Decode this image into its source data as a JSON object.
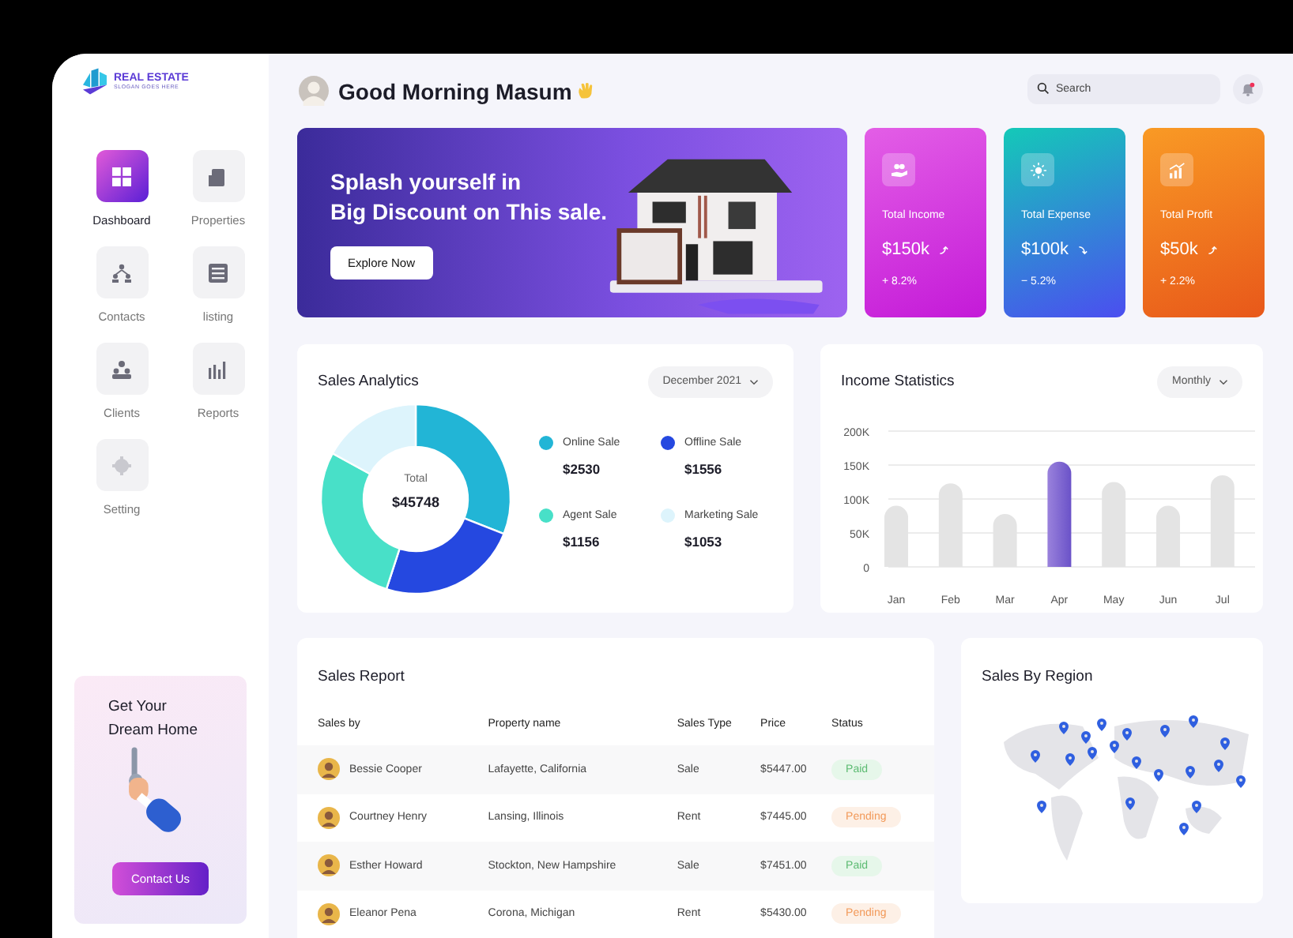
{
  "brand": {
    "name": "REAL ESTATE",
    "slogan": "SLOGAN GOES HERE"
  },
  "sidebar": {
    "items": [
      {
        "label": "Dashboard",
        "kind": "dashboard",
        "selected": true
      },
      {
        "label": "Properties",
        "kind": "properties",
        "selected": false
      },
      {
        "label": "Contacts",
        "kind": "contacts",
        "selected": false
      },
      {
        "label": "listing",
        "kind": "listing",
        "selected": false
      },
      {
        "label": "Clients",
        "kind": "clients",
        "selected": false
      },
      {
        "label": "Reports",
        "kind": "reports",
        "selected": false
      },
      {
        "label": "Setting",
        "kind": "setting",
        "selected": false
      }
    ],
    "promo": {
      "title": "Get Your Dream Home",
      "button": "Contact Us"
    }
  },
  "header": {
    "greeting": "Good Morning Masum",
    "search": {
      "placeholder": "Search"
    }
  },
  "banner": {
    "title_lines": [
      "Splash yourself in",
      "Big Discount on This sale."
    ],
    "button": "Explore Now"
  },
  "stats": [
    {
      "kind": "income",
      "label": "Total Income",
      "value": "$150k",
      "rising": true,
      "change": "+ 8.2%"
    },
    {
      "kind": "expense",
      "label": "Total Expense",
      "value": "$100k",
      "rising": false,
      "change": "− 5.2%"
    },
    {
      "kind": "profit",
      "label": "Total Profit",
      "value": "$50k",
      "rising": true,
      "change": "+ 2.2%"
    }
  ],
  "sales_analytics": {
    "title": "Sales Analytics",
    "period": "December 2021",
    "total_label": "Total",
    "total": "$45748",
    "chart_data": {
      "type": "donut",
      "categories": [
        "Online Sale",
        "Offline Sale",
        "Agent Sale",
        "Marketing Sale"
      ],
      "values": [
        31,
        24,
        28,
        17
      ]
    },
    "legend": [
      {
        "value": "$2530",
        "color": "#22b5d6"
      },
      {
        "value": "$1556",
        "color": "#2548e0"
      },
      {
        "value": "$1156",
        "color": "#48e0c8"
      },
      {
        "value": "$1053",
        "color": "#ddf4fc"
      }
    ]
  },
  "income_statistics": {
    "title": "Income Statistics",
    "period": "Monthly",
    "chart_data": {
      "type": "bar",
      "categories": [
        "Jan",
        "Feb",
        "Mar",
        "Apr",
        "May",
        "Jun",
        "Jul"
      ],
      "grid": true,
      "series": [
        {
          "color": "#e4e4e4",
          "values": [
            90,
            123,
            78,
            null,
            125,
            90,
            135
          ]
        },
        {
          "color": "#6a52c8",
          "values": [
            null,
            null,
            null,
            155,
            null,
            null,
            null
          ]
        }
      ],
      "ylim": [
        0,
        200
      ],
      "yticks": [
        {
          "value": 0,
          "label": "0"
        },
        {
          "value": 50,
          "label": "50K"
        },
        {
          "value": 100,
          "label": "100K"
        },
        {
          "value": 150,
          "label": "150K"
        },
        {
          "value": 200,
          "label": "200K"
        }
      ]
    }
  },
  "sales_report": {
    "title": "Sales Report",
    "columns": [
      "Sales by",
      "Property name",
      "Sales Type",
      "Price",
      "Status"
    ],
    "rows": [
      {
        "sales_by": "Bessie Cooper",
        "property": "Lafayette, California",
        "type": "Sale",
        "price": "$5447.00",
        "status": "Paid",
        "kind": "paid"
      },
      {
        "sales_by": "Courtney Henry",
        "property": "Lansing, Illinois",
        "type": "Rent",
        "price": "$7445.00",
        "status": "Pending",
        "kind": "pending"
      },
      {
        "sales_by": "Esther Howard",
        "property": "Stockton, New Hampshire",
        "type": "Sale",
        "price": "$7451.00",
        "status": "Paid",
        "kind": "paid"
      },
      {
        "sales_by": "Eleanor Pena",
        "property": "Corona, Michigan",
        "type": "Rent",
        "price": "$5430.00",
        "status": "Pending",
        "kind": "pending"
      }
    ]
  },
  "sales_by_region": {
    "title": "Sales By Region"
  }
}
